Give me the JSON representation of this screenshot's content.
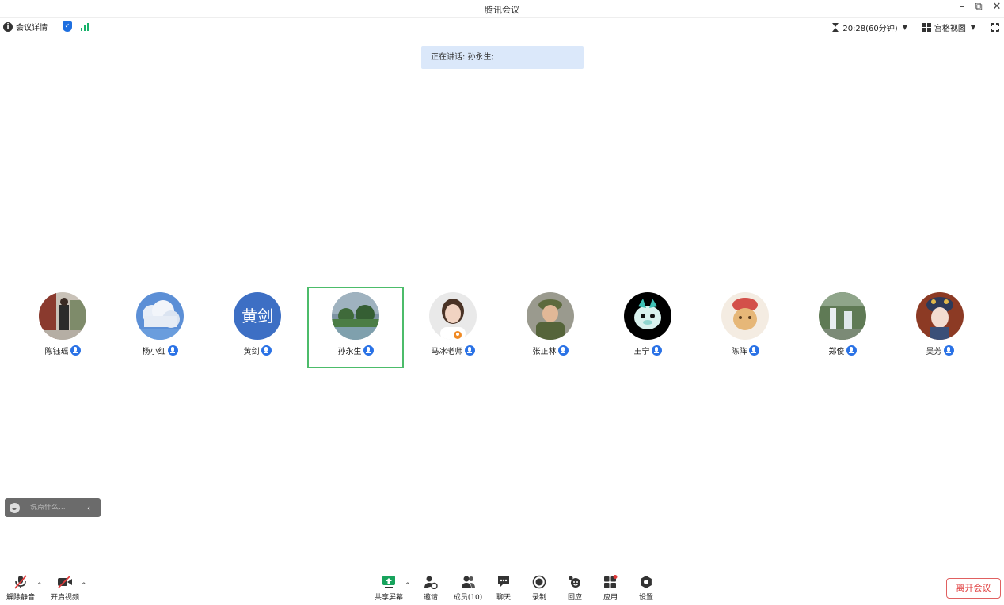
{
  "window": {
    "title": "腾讯会议"
  },
  "infobar": {
    "meeting_details": "会议详情",
    "timer": "20:28(60分钟)",
    "view_mode": "宫格视图"
  },
  "speaking": {
    "text": "正在讲话: 孙永生;"
  },
  "participants": [
    {
      "name": "陈钰瑶"
    },
    {
      "name": "杨小红"
    },
    {
      "name": "黄剑",
      "avatar_text": "黄剑"
    },
    {
      "name": "孙永生",
      "active": true
    },
    {
      "name": "马冰老师",
      "host": true
    },
    {
      "name": "张正林"
    },
    {
      "name": "王宁"
    },
    {
      "name": "陈阵"
    },
    {
      "name": "郑俊"
    },
    {
      "name": "吴芳"
    }
  ],
  "chat": {
    "placeholder": "说点什么..."
  },
  "toolbar": {
    "unmute": "解除静音",
    "start_video": "开启视频",
    "share_screen": "共享屏幕",
    "invite": "邀请",
    "members": "成员(10)",
    "chat": "聊天",
    "record": "录制",
    "reactions": "回应",
    "apps": "应用",
    "settings": "设置",
    "leave": "离开会议"
  },
  "colors": {
    "accent": "#2a72e6",
    "active_border": "#4cbc6a",
    "leave": "#e03c3c",
    "banner": "#dbe8fa"
  }
}
